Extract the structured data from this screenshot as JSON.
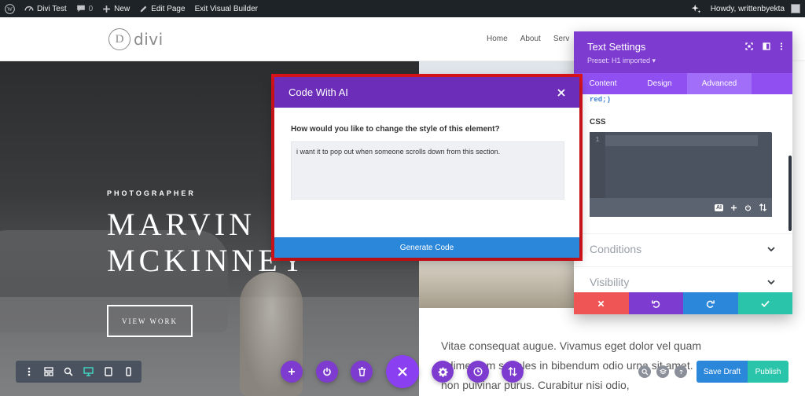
{
  "adminbar": {
    "site_name": "Divi Test",
    "comments_count": "0",
    "new_label": "New",
    "edit_label": "Edit Page",
    "exit_label": "Exit Visual Builder",
    "howdy": "Howdy, writtenbyekta"
  },
  "header": {
    "logo_letter": "D",
    "logo_text": "divi",
    "nav": [
      "Home",
      "About",
      "Serv"
    ]
  },
  "hero": {
    "kicker": "PHOTOGRAPHER",
    "title_line1": "MARVIN",
    "title_line2": "MCKINNEY",
    "button": "VIEW WORK"
  },
  "body_text": "Vitae consequat augue. Vivamus eget dolor vel quam ndimentum sodales in bibendum odio urna sit amet. In non pulvinar purus. Curabitur nisi odio,",
  "modal": {
    "title": "Code With AI",
    "question": "How would you like to change the style of this element?",
    "input_value": "i want it to pop out when someone scrolls down from this section.",
    "generate": "Generate Code"
  },
  "panel": {
    "title": "Text Settings",
    "preset": "Preset: H1 imported ▾",
    "tabs": [
      "Content",
      "Design",
      "Advanced"
    ],
    "active_tab": "Advanced",
    "code_snippet": "red;)",
    "css_label": "CSS",
    "line_number": "1",
    "ai_badge": "AI",
    "sections": [
      "Conditions",
      "Visibility"
    ]
  },
  "footer": {
    "save_draft": "Save Draft",
    "publish": "Publish"
  },
  "colors": {
    "purple_header": "#7e3bd0",
    "modal_header": "#6c2eb9",
    "highlight_outline": "#e0141b",
    "blue": "#2b87da",
    "teal": "#29c4a9",
    "red": "#ef5555"
  }
}
